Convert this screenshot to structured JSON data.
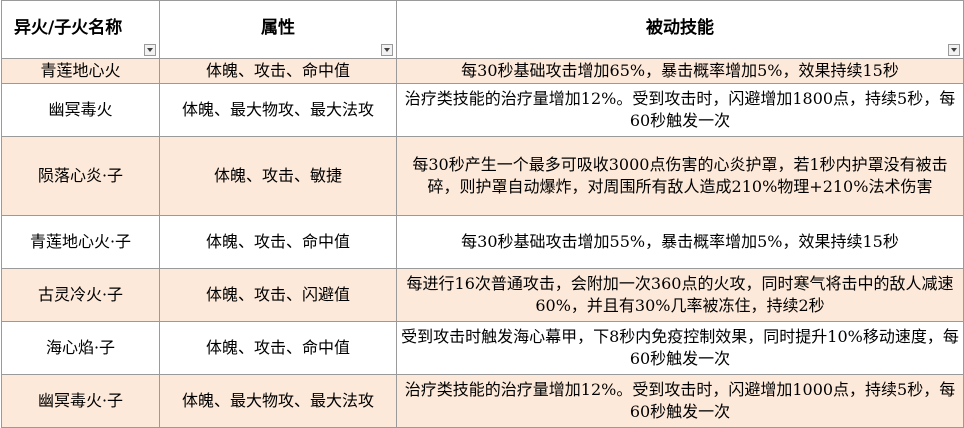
{
  "headers": {
    "name": "异火/子火名称",
    "attributes": "属性",
    "skill": "被动技能"
  },
  "rows": [
    {
      "name": "青莲地心火",
      "attributes": "体魄、攻击、命中值",
      "skill": "每30秒基础攻击增加65%，暴击概率增加5%，效果持续15秒"
    },
    {
      "name": "幽冥毒火",
      "attributes": "体魄、最大物攻、最大法攻",
      "skill": "治疗类技能的治疗量增加12%。受到攻击时，闪避增加1800点，持续5秒，每60秒触发一次"
    },
    {
      "name": "陨落心炎·子",
      "attributes": "体魄、攻击、敏捷",
      "skill": "每30秒产生一个最多可吸收3000点伤害的心炎护罩，若1秒内护罩没有被击碎，则护罩自动爆炸，对周围所有敌人造成210%物理+210%法术伤害"
    },
    {
      "name": "青莲地心火·子",
      "attributes": "体魄、攻击、命中值",
      "skill": "每30秒基础攻击增加55%，暴击概率增加5%，效果持续15秒"
    },
    {
      "name": "古灵冷火·子",
      "attributes": "体魄、攻击、闪避值",
      "skill": "每进行16次普通攻击，会附加一次360点的火攻，同时寒气将击中的敌人减速60%，并且有30%几率被冻住，持续2秒"
    },
    {
      "name": "海心焰·子",
      "attributes": "体魄、攻击、命中值",
      "skill": "受到攻击时触发海心幕甲，下8秒内免疫控制效果，同时提升10%移动速度，每60秒触发一次"
    },
    {
      "name": "幽冥毒火·子",
      "attributes": "体魄、最大物攻、最大法攻",
      "skill": "治疗类技能的治疗量增加12%。受到攻击时，闪避增加1000点，持续5秒，每60秒触发一次"
    }
  ]
}
